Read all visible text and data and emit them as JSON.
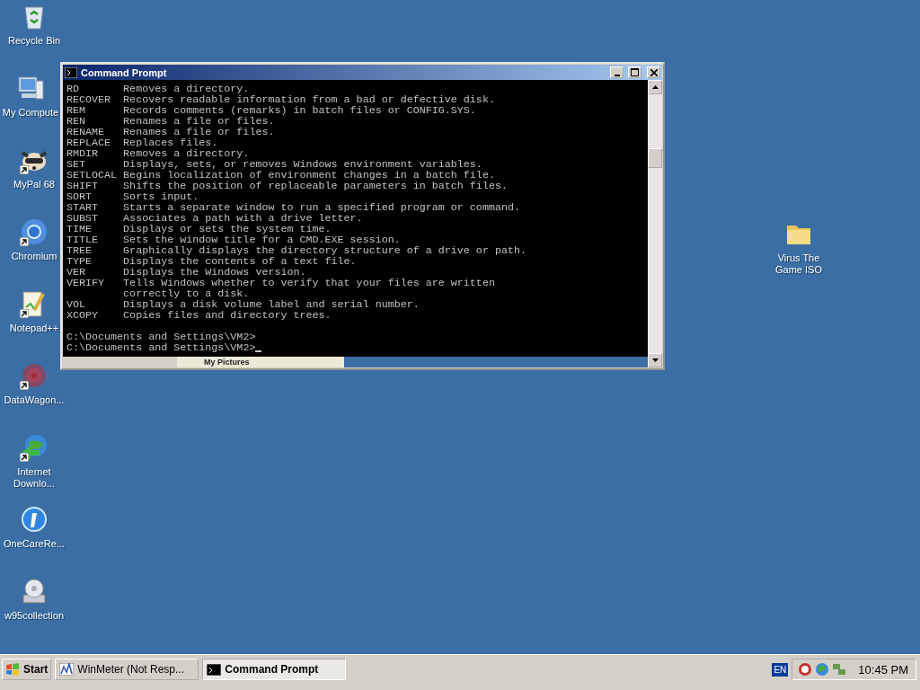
{
  "desktop_icons": [
    {
      "label": "Recycle Bin",
      "kind": "recycle-bin",
      "shortcut": false
    },
    {
      "label": "My Compute",
      "kind": "computer",
      "shortcut": false
    },
    {
      "label": "MyPal 68",
      "kind": "raccoon",
      "shortcut": true
    },
    {
      "label": "Chromium",
      "kind": "browser",
      "shortcut": true
    },
    {
      "label": "Notepad++",
      "kind": "notepad",
      "shortcut": true
    },
    {
      "label": "DataWagon...",
      "kind": "target",
      "shortcut": true
    },
    {
      "label": "Internet Downlo...",
      "kind": "globe",
      "shortcut": true
    },
    {
      "label": "OneCareRe...",
      "kind": "info",
      "shortcut": false
    },
    {
      "label": "w95collection",
      "kind": "disc",
      "shortcut": false
    },
    {
      "label": "Virus The Game ISO",
      "kind": "folder",
      "shortcut": false
    }
  ],
  "window": {
    "title": "Command Prompt",
    "console": {
      "entries": [
        {
          "command": "RD",
          "description": "Removes a directory."
        },
        {
          "command": "RECOVER",
          "description": "Recovers readable information from a bad or defective disk."
        },
        {
          "command": "REM",
          "description": "Records comments (remarks) in batch files or CONFIG.SYS."
        },
        {
          "command": "REN",
          "description": "Renames a file or files."
        },
        {
          "command": "RENAME",
          "description": "Renames a file or files."
        },
        {
          "command": "REPLACE",
          "description": "Replaces files."
        },
        {
          "command": "RMDIR",
          "description": "Removes a directory."
        },
        {
          "command": "SET",
          "description": "Displays, sets, or removes Windows environment variables."
        },
        {
          "command": "SETLOCAL",
          "description": "Begins localization of environment changes in a batch file."
        },
        {
          "command": "SHIFT",
          "description": "Shifts the position of replaceable parameters in batch files."
        },
        {
          "command": "SORT",
          "description": "Sorts input."
        },
        {
          "command": "START",
          "description": "Starts a separate window to run a specified program or command."
        },
        {
          "command": "SUBST",
          "description": "Associates a path with a drive letter."
        },
        {
          "command": "TIME",
          "description": "Displays or sets the system time."
        },
        {
          "command": "TITLE",
          "description": "Sets the window title for a CMD.EXE session."
        },
        {
          "command": "TREE",
          "description": "Graphically displays the directory structure of a drive or path."
        },
        {
          "command": "TYPE",
          "description": "Displays the contents of a text file."
        },
        {
          "command": "VER",
          "description": "Displays the Windows version."
        },
        {
          "command": "VERIFY",
          "description": "Tells Windows whether to verify that your files are written"
        },
        {
          "description": "correctly to a disk."
        },
        {
          "command": "VOL",
          "description": "Displays a disk volume label and serial number."
        },
        {
          "command": "XCOPY",
          "description": "Copies files and directory trees."
        }
      ],
      "prompts": [
        "C:\\Documents and Settings\\VM2>",
        "C:\\Documents and Settings\\VM2>"
      ]
    },
    "glitch_label": "My Pictures"
  },
  "taskbar": {
    "start": "Start",
    "tasks": [
      {
        "label": "WinMeter (Not Resp...",
        "selected": false
      },
      {
        "label": "Command Prompt",
        "selected": true
      }
    ],
    "language": "EN",
    "clock": "10:45 PM"
  }
}
